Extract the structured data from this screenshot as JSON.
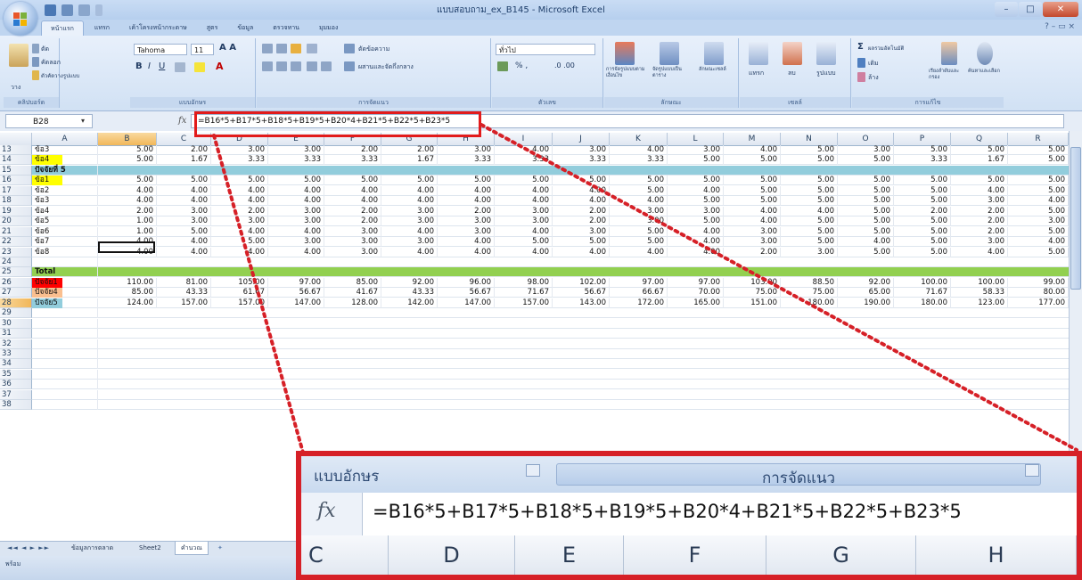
{
  "window": {
    "title": "แบบสอบถาม_ex_B145 - Microsoft Excel",
    "controls": [
      "–",
      "□",
      "✕"
    ]
  },
  "ribbon": {
    "tabs": [
      "หน้าแรก",
      "แทรก",
      "เค้าโครงหน้ากระดาษ",
      "สูตร",
      "ข้อมูล",
      "ตรวจทาน",
      "มุมมอง"
    ],
    "help": "? –  ▭  ×",
    "clipboard": {
      "paste": "วาง",
      "cut": "ตัด",
      "copy": "คัดลอก",
      "format_painter": "ตัวคัดวางรูปแบบ",
      "label": "คลิปบอร์ด"
    },
    "font": {
      "name": "Tahoma",
      "size": "11",
      "label": "แบบอักษร"
    },
    "alignment": {
      "wrap": "ตัดข้อความ",
      "merge": "ผสานและจัดกึ่งกลาง",
      "label": "การจัดแนว"
    },
    "number": {
      "format": "ทั่วไป",
      "label": "ตัวเลข"
    },
    "styles": {
      "conditional": "การจัดรูปแบบตามเงื่อนไข",
      "table": "จัดรูปแบบเป็นตาราง",
      "cell": "ลักษณะเซลล์",
      "label": "ลักษณะ"
    },
    "cells": {
      "insert": "แทรก",
      "delete": "ลบ",
      "format": "รูปแบบ",
      "label": "เซลล์"
    },
    "editing": {
      "autosum": "ผลรวมอัตโนมัติ",
      "fill": "เติม",
      "clear": "ล้าง",
      "sort": "เรียงลำดับและกรอง",
      "find": "ค้นหาและเลือก",
      "label": "การแก้ไข"
    }
  },
  "formula_bar": {
    "name_box": "B28",
    "fx": "fx",
    "formula": "=B16*5+B17*5+B18*5+B19*5+B20*4+B21*5+B22*5+B23*5"
  },
  "columns": [
    "A",
    "B",
    "C",
    "D",
    "E",
    "F",
    "G",
    "H",
    "I",
    "J",
    "K",
    "L",
    "M",
    "N",
    "O",
    "P",
    "Q",
    "R"
  ],
  "rows": [
    {
      "num": "13",
      "label": "ข้อ3",
      "hl": "",
      "bold": false,
      "band": "",
      "values": [
        "5.00",
        "2.00",
        "3.00",
        "3.00",
        "2.00",
        "2.00",
        "3.00",
        "4.00",
        "3.00",
        "4.00",
        "3.00",
        "4.00",
        "5.00",
        "3.00",
        "5.00",
        "5.00",
        "5.00"
      ]
    },
    {
      "num": "14",
      "label": "ข้อ4",
      "hl": "#ffff00",
      "bold": false,
      "band": "",
      "values": [
        "5.00",
        "1.67",
        "3.33",
        "3.33",
        "3.33",
        "1.67",
        "3.33",
        "3.33",
        "3.33",
        "3.33",
        "5.00",
        "5.00",
        "5.00",
        "5.00",
        "3.33",
        "1.67",
        "5.00"
      ]
    },
    {
      "num": "15",
      "label": "ปัจจัยที่ 5",
      "hl": "",
      "bold": true,
      "band": "#92cddc",
      "values": []
    },
    {
      "num": "16",
      "label": "ข้อ1",
      "hl": "#ffff00",
      "bold": false,
      "band": "",
      "values": [
        "5.00",
        "5.00",
        "5.00",
        "5.00",
        "5.00",
        "5.00",
        "5.00",
        "5.00",
        "5.00",
        "5.00",
        "5.00",
        "5.00",
        "5.00",
        "5.00",
        "5.00",
        "5.00",
        "5.00"
      ]
    },
    {
      "num": "17",
      "label": "ข้อ2",
      "hl": "",
      "bold": false,
      "band": "",
      "values": [
        "4.00",
        "4.00",
        "4.00",
        "4.00",
        "4.00",
        "4.00",
        "4.00",
        "4.00",
        "4.00",
        "5.00",
        "4.00",
        "5.00",
        "5.00",
        "5.00",
        "5.00",
        "4.00",
        "5.00"
      ]
    },
    {
      "num": "18",
      "label": "ข้อ3",
      "hl": "",
      "bold": false,
      "band": "",
      "values": [
        "4.00",
        "4.00",
        "4.00",
        "4.00",
        "4.00",
        "4.00",
        "4.00",
        "4.00",
        "4.00",
        "4.00",
        "5.00",
        "5.00",
        "5.00",
        "5.00",
        "5.00",
        "3.00",
        "4.00"
      ]
    },
    {
      "num": "19",
      "label": "ข้อ4",
      "hl": "",
      "bold": false,
      "band": "",
      "values": [
        "2.00",
        "3.00",
        "2.00",
        "3.00",
        "2.00",
        "3.00",
        "2.00",
        "3.00",
        "2.00",
        "3.00",
        "3.00",
        "4.00",
        "4.00",
        "5.00",
        "2.00",
        "2.00",
        "5.00"
      ]
    },
    {
      "num": "20",
      "label": "ข้อ5",
      "hl": "",
      "bold": false,
      "band": "",
      "values": [
        "1.00",
        "3.00",
        "3.00",
        "3.00",
        "2.00",
        "3.00",
        "3.00",
        "3.00",
        "2.00",
        "3.00",
        "5.00",
        "4.00",
        "5.00",
        "5.00",
        "5.00",
        "2.00",
        "3.00"
      ]
    },
    {
      "num": "21",
      "label": "ข้อ6",
      "hl": "",
      "bold": false,
      "band": "",
      "values": [
        "1.00",
        "5.00",
        "4.00",
        "4.00",
        "3.00",
        "4.00",
        "3.00",
        "4.00",
        "3.00",
        "5.00",
        "4.00",
        "3.00",
        "5.00",
        "5.00",
        "5.00",
        "2.00",
        "5.00"
      ]
    },
    {
      "num": "22",
      "label": "ข้อ7",
      "hl": "",
      "bold": false,
      "band": "",
      "values": [
        "4.00",
        "4.00",
        "5.00",
        "3.00",
        "3.00",
        "3.00",
        "4.00",
        "5.00",
        "5.00",
        "5.00",
        "4.00",
        "3.00",
        "5.00",
        "4.00",
        "5.00",
        "3.00",
        "4.00"
      ]
    },
    {
      "num": "23",
      "label": "ข้อ8",
      "hl": "",
      "bold": false,
      "band": "",
      "values": [
        "4.00",
        "4.00",
        "4.00",
        "4.00",
        "3.00",
        "4.00",
        "4.00",
        "4.00",
        "4.00",
        "4.00",
        "4.00",
        "2.00",
        "3.00",
        "5.00",
        "5.00",
        "4.00",
        "5.00"
      ]
    },
    {
      "num": "24",
      "label": "",
      "hl": "",
      "bold": false,
      "band": "",
      "values": []
    },
    {
      "num": "25",
      "label": "Total",
      "hl": "",
      "bold": true,
      "band": "#92d050",
      "values": []
    },
    {
      "num": "26",
      "label": "ปัจจัย1",
      "hl": "#ff0000",
      "bold": false,
      "band": "",
      "values": [
        "110.00",
        "81.00",
        "105.00",
        "97.00",
        "85.00",
        "92.00",
        "96.00",
        "98.00",
        "102.00",
        "97.00",
        "97.00",
        "103.00",
        "88.50",
        "92.00",
        "100.00",
        "100.00",
        "99.00"
      ]
    },
    {
      "num": "27",
      "label": "ปัจจัย4",
      "hl": "#fabf8f",
      "bold": false,
      "band": "",
      "values": [
        "85.00",
        "43.33",
        "61.67",
        "56.67",
        "41.67",
        "43.33",
        "56.67",
        "71.67",
        "56.67",
        "66.67",
        "70.00",
        "75.00",
        "75.00",
        "65.00",
        "71.67",
        "58.33",
        "80.00"
      ]
    },
    {
      "num": "28",
      "label": "ปัจจัย5",
      "hl": "#92cddc",
      "bold": false,
      "band": "",
      "values": [
        "124.00",
        "157.00",
        "157.00",
        "147.00",
        "128.00",
        "142.00",
        "147.00",
        "157.00",
        "143.00",
        "172.00",
        "165.00",
        "151.00",
        "180.00",
        "190.00",
        "180.00",
        "123.00",
        "177.00"
      ]
    },
    {
      "num": "29",
      "label": "",
      "hl": "",
      "bold": false,
      "band": "",
      "values": []
    },
    {
      "num": "30",
      "label": "",
      "hl": "",
      "bold": false,
      "band": "",
      "values": []
    },
    {
      "num": "31",
      "label": "",
      "hl": "",
      "bold": false,
      "band": "",
      "values": []
    },
    {
      "num": "32",
      "label": "",
      "hl": "",
      "bold": false,
      "band": "",
      "values": []
    },
    {
      "num": "33",
      "label": "",
      "hl": "",
      "bold": false,
      "band": "",
      "values": []
    },
    {
      "num": "34",
      "label": "",
      "hl": "",
      "bold": false,
      "band": "",
      "values": []
    },
    {
      "num": "35",
      "label": "",
      "hl": "",
      "bold": false,
      "band": "",
      "values": []
    },
    {
      "num": "36",
      "label": "",
      "hl": "",
      "bold": false,
      "band": "",
      "values": []
    },
    {
      "num": "37",
      "label": "",
      "hl": "",
      "bold": false,
      "band": "",
      "values": []
    },
    {
      "num": "38",
      "label": "",
      "hl": "",
      "bold": false,
      "band": "",
      "values": []
    }
  ],
  "sheet_tabs": [
    "ข้อมูลการตลาด",
    "Sheet2",
    "คำนวณ"
  ],
  "status": {
    "text": "พร้อม"
  },
  "zoom_callout": {
    "font_group": "แบบอักษร",
    "align_group": "การจัดแนว",
    "fx": "fx",
    "formula": "=B16*5+B17*5+B18*5+B19*5+B20*4+B21*5+B22*5+B23*5",
    "columns": [
      "C",
      "D",
      "E",
      "F",
      "G",
      "H"
    ]
  },
  "colors": {
    "highlight_border": "#e21b1b",
    "callout_border": "#d62027",
    "selection": "#f1b75a"
  }
}
